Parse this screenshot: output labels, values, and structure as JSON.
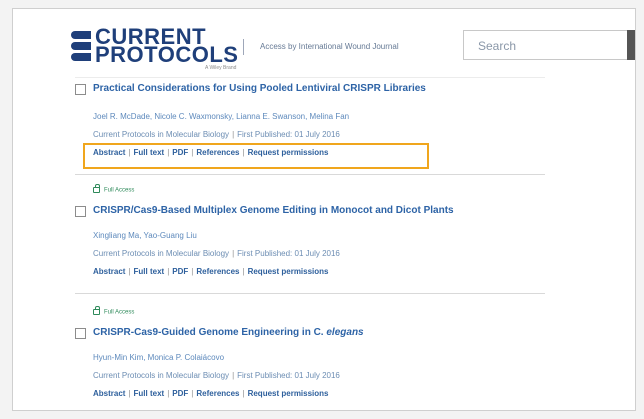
{
  "header": {
    "logo_line1": "CURRENT",
    "logo_line2": "PROTOCOLS",
    "logo_tagline": "A Wiley Brand",
    "access_text": "Access by International Wound Journal",
    "search_placeholder": "Search"
  },
  "articles": [
    {
      "title": "Practical Considerations for Using Pooled Lentiviral CRISPR Libraries",
      "authors": "Joel R. McDade,  Nicole C. Waxmonsky,  Lianna E. Swanson,  Melina Fan",
      "journal": "Current Protocols in Molecular Biology",
      "published": "First Published:  01 July 2016",
      "links": [
        "Abstract",
        "Full text",
        "PDF",
        "References",
        "Request permissions"
      ]
    },
    {
      "access": "Full Access",
      "title": "CRISPR/Cas9-Based Multiplex Genome Editing in Monocot and Dicot Plants",
      "authors": "Xingliang Ma,  Yao-Guang Liu",
      "journal": "Current Protocols in Molecular Biology",
      "published": "First Published:  01 July 2016",
      "links": [
        "Abstract",
        "Full text",
        "PDF",
        "References",
        "Request permissions"
      ]
    },
    {
      "access": "Full Access",
      "title": "CRISPR-Cas9-Guided Genome Engineering in C. elegans",
      "authors": "Hyun-Min Kim,  Monica P. Colaiácovo",
      "journal": "Current Protocols in Molecular Biology",
      "published": "First Published:  01 July 2016",
      "links": [
        "Abstract",
        "Full text",
        "PDF",
        "References",
        "Request permissions"
      ]
    }
  ],
  "colors": {
    "brand": "#1f3f7a",
    "link": "#2d63a6",
    "highlight": "#f0a61d",
    "access": "#2e8a5a"
  }
}
